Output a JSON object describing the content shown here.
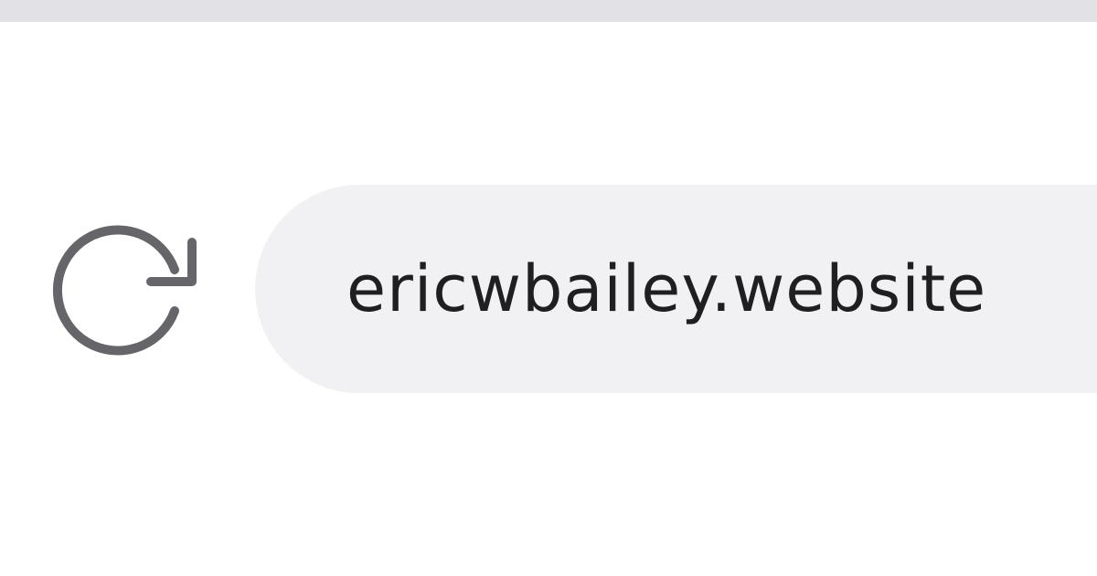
{
  "toolbar": {
    "reload_icon": "reload-icon",
    "address": {
      "url": "ericwbailey.website"
    }
  },
  "colors": {
    "top_bar": "#e2e2e6",
    "address_bar_bg": "#f1f1f3",
    "icon": "#66666a",
    "text": "#1f1f22"
  }
}
